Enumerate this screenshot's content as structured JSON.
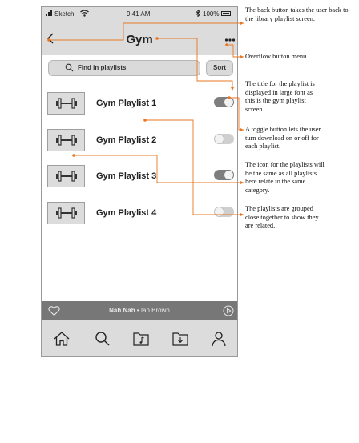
{
  "status_bar": {
    "carrier": "Sketch",
    "time": "9:41 AM",
    "battery": "100%"
  },
  "nav": {
    "title": "Gym"
  },
  "search": {
    "placeholder": "Find in playlists",
    "sort_label": "Sort"
  },
  "playlists": [
    {
      "name": "Gym Playlist 1",
      "download": true
    },
    {
      "name": "Gym Playlist 2",
      "download": false
    },
    {
      "name": "Gym Playlist 3",
      "download": true
    },
    {
      "name": "Gym Playlist 4",
      "download": false
    }
  ],
  "now_playing": {
    "title": "Nah Nah",
    "separator": " • ",
    "artist": "Ian Brown"
  },
  "tabs": [
    "home-icon",
    "search-icon",
    "library-music-icon",
    "downloads-folder-icon",
    "profile-icon"
  ],
  "annotations": [
    "The back button takes the user back to the library playlist screen.",
    "Overflow button menu.",
    "The title for the playlist is displayed in large font as this is the gym playlist screen.",
    "A toggle button lets the user turn download on or off for each playlist.",
    "The icon for the playlists will be the same as all playlists here relate to the same category.",
    "The playlists are grouped close together to show they are related."
  ],
  "colors": {
    "accent": "#e87722",
    "chrome": "#dcdcdc",
    "player": "#777777"
  }
}
